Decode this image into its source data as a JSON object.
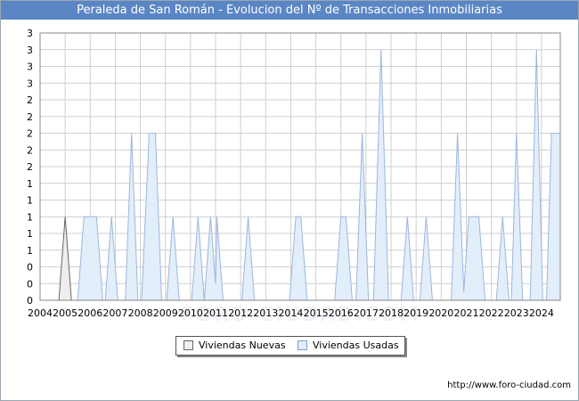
{
  "title": "Peraleda de San Román - Evolucion del Nº de Transacciones Inmobiliarias",
  "source": "http://www.foro-ciudad.com",
  "watermark": "FORO-CIUDAD.COM",
  "colors": {
    "title_bg": "#5b86c5",
    "nuevas_fill": "#eeeeee",
    "nuevas_line": "#666666",
    "usadas_fill": "#e3eefb",
    "usadas_line": "#9db6dc",
    "grid": "#cfcfcf"
  },
  "chart_data": {
    "type": "area",
    "title": "Peraleda de San Román - Evolucion del Nº de Transacciones Inmobiliarias",
    "xlim": [
      2004,
      2024.75
    ],
    "ylim": [
      0,
      3.2
    ],
    "y_tick_values": [
      0,
      0.2,
      0.4,
      0.6,
      0.8,
      1,
      1.2,
      1.4,
      1.6,
      1.8,
      2,
      2.2,
      2.4,
      2.6,
      2.8,
      3,
      3.2
    ],
    "y_tick_labels": [
      "0",
      "0",
      "0",
      "1",
      "1",
      "1",
      "1",
      "1",
      "2",
      "2",
      "2",
      "2",
      "2",
      "3",
      "3",
      "3",
      "3"
    ],
    "x_ticks": [
      "2004",
      "2005",
      "2006",
      "2007",
      "2008",
      "2009",
      "2010",
      "2011",
      "2012",
      "2013",
      "2014",
      "2015",
      "2016",
      "2017",
      "2018",
      "2019",
      "2020",
      "2021",
      "2022",
      "2023",
      "2024"
    ],
    "grid": true,
    "legend_position": "bottom",
    "series": [
      {
        "name": "Viviendas Nuevas",
        "color": "#666666",
        "points": [
          [
            2004.75,
            0
          ],
          [
            2005.0,
            1
          ],
          [
            2005.25,
            0
          ]
        ]
      },
      {
        "name": "Viviendas Usadas",
        "color": "#9db6dc",
        "points": [
          [
            2005.5,
            0
          ],
          [
            2005.75,
            1
          ],
          [
            2006.25,
            1
          ],
          [
            2006.5,
            0
          ],
          [
            2006.6,
            0
          ],
          [
            2006.85,
            1
          ],
          [
            2007.1,
            0
          ],
          [
            2007.4,
            0
          ],
          [
            2007.65,
            2
          ],
          [
            2007.9,
            0
          ],
          [
            2008.05,
            0
          ],
          [
            2008.35,
            2
          ],
          [
            2008.6,
            2
          ],
          [
            2008.85,
            0
          ],
          [
            2009.05,
            0
          ],
          [
            2009.3,
            1
          ],
          [
            2009.55,
            0
          ],
          [
            2010.05,
            0
          ],
          [
            2010.3,
            1
          ],
          [
            2010.55,
            0
          ],
          [
            2010.55,
            0
          ],
          [
            2010.8,
            1
          ],
          [
            2011.0,
            0.2
          ],
          [
            2011.05,
            1
          ],
          [
            2011.3,
            0
          ],
          [
            2012.05,
            0
          ],
          [
            2012.3,
            1
          ],
          [
            2012.55,
            0
          ],
          [
            2013.95,
            0
          ],
          [
            2014.2,
            1
          ],
          [
            2014.4,
            1
          ],
          [
            2014.65,
            0
          ],
          [
            2015.75,
            0
          ],
          [
            2016.0,
            1
          ],
          [
            2016.2,
            1
          ],
          [
            2016.45,
            0
          ],
          [
            2016.6,
            0
          ],
          [
            2016.85,
            2
          ],
          [
            2017.1,
            0
          ],
          [
            2017.3,
            0
          ],
          [
            2017.6,
            3
          ],
          [
            2017.9,
            0
          ],
          [
            2018.4,
            0
          ],
          [
            2018.65,
            1
          ],
          [
            2018.9,
            0
          ],
          [
            2019.15,
            0
          ],
          [
            2019.4,
            1
          ],
          [
            2019.65,
            0
          ],
          [
            2020.4,
            0
          ],
          [
            2020.65,
            2
          ],
          [
            2020.9,
            0.1
          ],
          [
            2021.1,
            1
          ],
          [
            2021.5,
            1
          ],
          [
            2021.75,
            0
          ],
          [
            2022.2,
            0
          ],
          [
            2022.45,
            1
          ],
          [
            2022.7,
            0
          ],
          [
            2022.8,
            0
          ],
          [
            2023.0,
            2
          ],
          [
            2023.25,
            0
          ],
          [
            2023.55,
            0
          ],
          [
            2023.8,
            3
          ],
          [
            2024.05,
            0
          ],
          [
            2024.2,
            0
          ],
          [
            2024.4,
            2
          ],
          [
            2024.75,
            2
          ]
        ]
      }
    ]
  }
}
